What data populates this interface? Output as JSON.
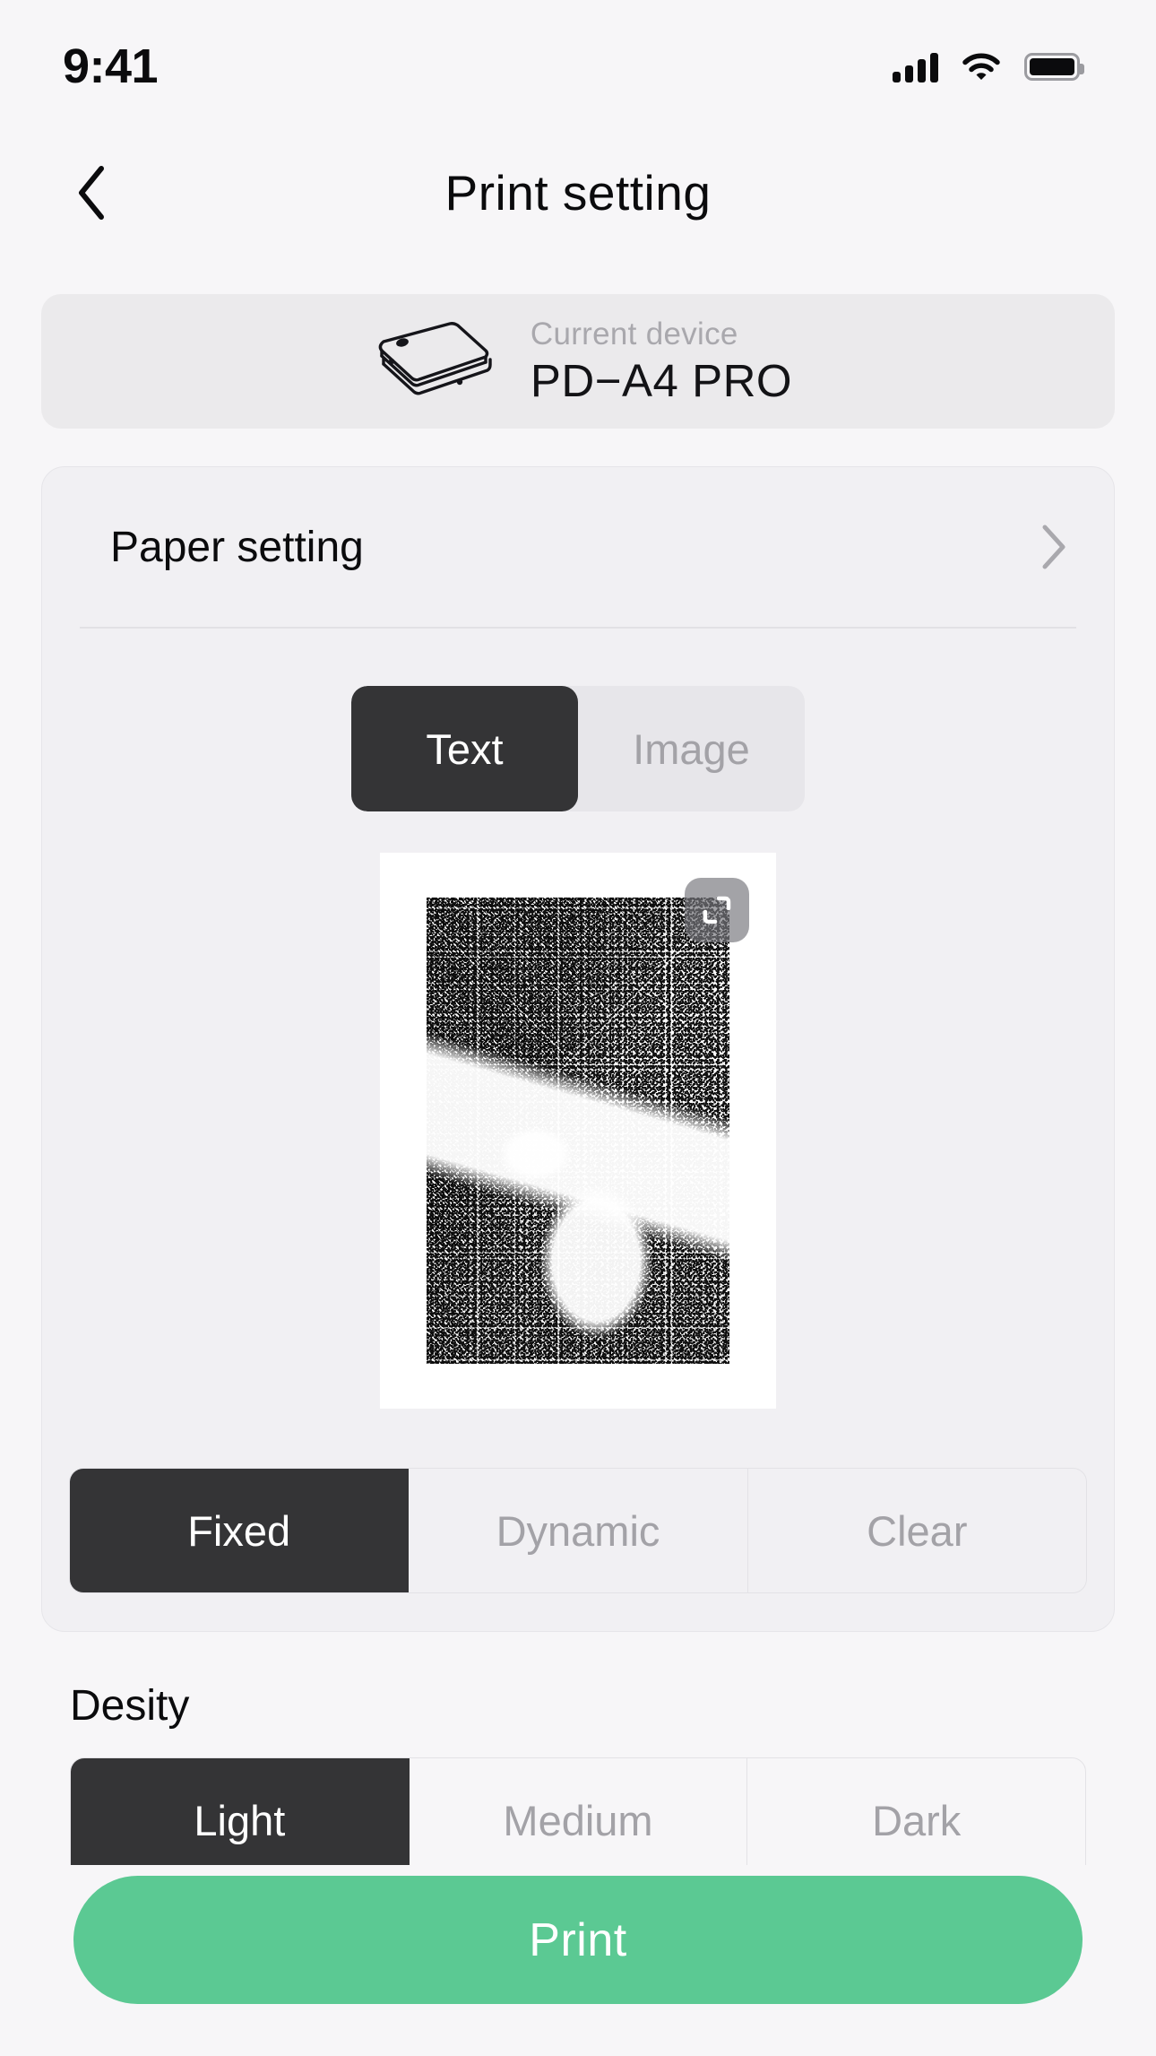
{
  "status_bar": {
    "time": "9:41",
    "cellular_icon": "cellular-signal-icon",
    "wifi_icon": "wifi-icon",
    "battery_icon": "battery-full-icon"
  },
  "nav": {
    "back_icon": "chevron-left-icon",
    "title": "Print setting"
  },
  "device": {
    "icon": "portable-printer-icon",
    "label": "Current device",
    "name": "PD−A4 PRO"
  },
  "paper_setting": {
    "label": "Paper setting",
    "chevron_icon": "chevron-right-icon"
  },
  "content_type": {
    "options": [
      {
        "label": "Text",
        "selected": true
      },
      {
        "label": "Image",
        "selected": false
      }
    ]
  },
  "preview": {
    "crop_icon": "crop-frame-icon",
    "image_description": "dithered black and white photo"
  },
  "print_mode": {
    "options": [
      {
        "label": "Fixed",
        "selected": true
      },
      {
        "label": "Dynamic",
        "selected": false
      },
      {
        "label": "Clear",
        "selected": false
      }
    ]
  },
  "density": {
    "title": "Desity",
    "options": [
      {
        "label": "Light",
        "selected": true
      },
      {
        "label": "Medium",
        "selected": false
      },
      {
        "label": "Dark",
        "selected": false
      }
    ]
  },
  "print_button": {
    "label": "Print"
  },
  "colors": {
    "page_background": "#F7F6F8",
    "card_background": "#F1F0F3",
    "device_card_background": "#EBEAEC",
    "segment_active": "#343436",
    "segment_inactive_text": "#A3A2A7",
    "accent_green": "#5BC993",
    "text_primary": "#0B0B0D",
    "text_muted": "#A9A8AD"
  }
}
